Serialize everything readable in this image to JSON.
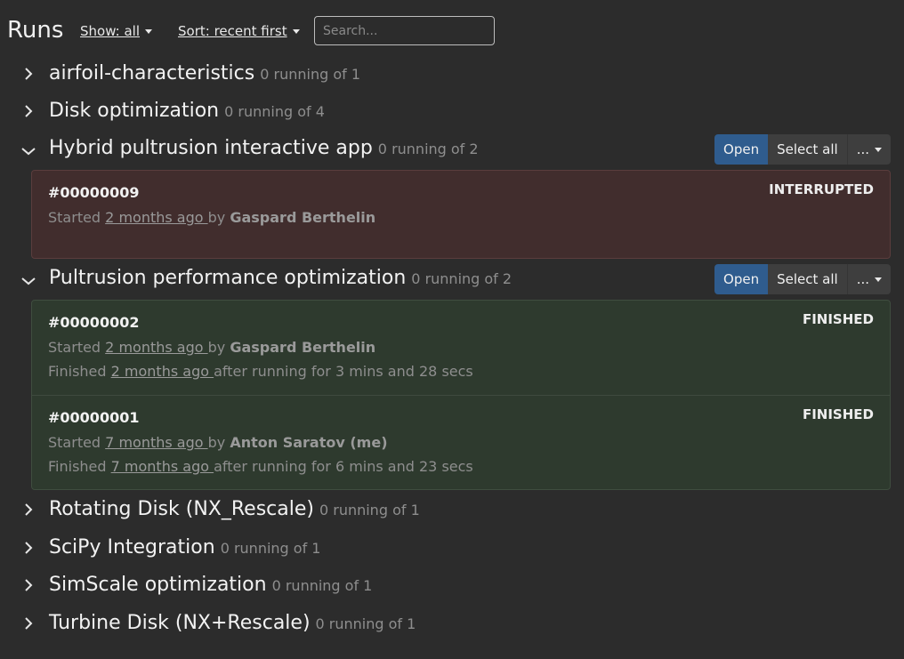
{
  "header": {
    "title": "Runs",
    "show_filter": "Show: all",
    "sort_filter": "Sort: recent first",
    "search_placeholder": "Search..."
  },
  "buttons": {
    "open": "Open",
    "select_all": "Select all",
    "more": "..."
  },
  "groups": [
    {
      "name": "airfoil-characteristics",
      "count": "0 running of 1",
      "expanded": false
    },
    {
      "name": "Disk optimization",
      "count": "0 running of 4",
      "expanded": false
    },
    {
      "name": "Hybrid pultrusion interactive app",
      "count": "0 running of 2",
      "expanded": true,
      "runs": [
        {
          "id": "#00000009",
          "status": "INTERRUPTED",
          "started_prefix": "Started ",
          "started_ago": "2 months ago ",
          "by": " by ",
          "user": "Gaspard Berthelin"
        }
      ]
    },
    {
      "name": "Pultrusion performance optimization",
      "count": "0 running of 2",
      "expanded": true,
      "runs": [
        {
          "id": "#00000002",
          "status": "FINISHED",
          "started_prefix": "Started ",
          "started_ago": "2 months ago ",
          "by": " by ",
          "user": "Gaspard Berthelin",
          "finished_prefix": "Finished ",
          "finished_ago": "2 months ago ",
          "duration": " after running for 3 mins and 28 secs"
        },
        {
          "id": "#00000001",
          "status": "FINISHED",
          "started_prefix": "Started ",
          "started_ago": "7 months ago ",
          "by": " by ",
          "user": "Anton Saratov  (me)",
          "finished_prefix": "Finished ",
          "finished_ago": "7 months ago ",
          "duration": " after running for 6 mins and 23 secs"
        }
      ]
    },
    {
      "name": "Rotating Disk (NX_Rescale)",
      "count": "0 running of 1",
      "expanded": false
    },
    {
      "name": "SciPy Integration",
      "count": "0 running of 1",
      "expanded": false
    },
    {
      "name": "SimScale optimization",
      "count": "0 running of 1",
      "expanded": false
    },
    {
      "name": "Turbine Disk (NX+Rescale)",
      "count": "0 running of 1",
      "expanded": false
    }
  ],
  "colors": {
    "background": "#2c2c2c",
    "interrupted_card": "#412d2d",
    "finished_card": "#2e3a2e",
    "open_button": "#2f5c8e"
  }
}
